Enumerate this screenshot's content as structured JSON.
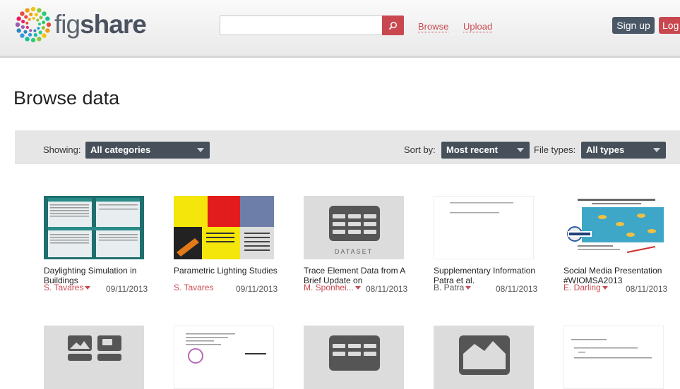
{
  "brand": {
    "name_light": "fig",
    "name_bold": "share"
  },
  "search": {
    "placeholder": ""
  },
  "nav": {
    "browse": "Browse",
    "upload": "Upload"
  },
  "auth": {
    "signup": "Sign up",
    "login": "Log"
  },
  "page": {
    "title": "Browse data"
  },
  "filters": {
    "showing_label": "Showing:",
    "showing_value": "All categories",
    "sort_label": "Sort by:",
    "sort_value": "Most recent",
    "filetypes_label": "File types:",
    "filetypes_value": "All types"
  },
  "items": [
    {
      "title": "Daylighting Simulation in Buildings",
      "author": "S. Tavares",
      "date": "09/11/2013",
      "thumb": "poster-teal"
    },
    {
      "title": "Parametric Lighting Studies",
      "author": "S. Tavares",
      "date": "09/11/2013",
      "thumb": "colorful-grid"
    },
    {
      "title": "Trace Element Data from A Brief Update on",
      "author": "M. Sponhei...",
      "date": "08/11/2013",
      "thumb": "dataset-icon",
      "thumb_label": "DATASET"
    },
    {
      "title": "Supplementary Information Patra et al.",
      "author": "B. Patra",
      "date": "08/11/2013",
      "thumb": "text-document"
    },
    {
      "title": "Social Media Presentation #WIOMSA2013",
      "author": "E. Darling",
      "date": "08/11/2013",
      "thumb": "fish-slide"
    }
  ],
  "colors": {
    "accent": "#c9484f",
    "dark": "#47505a",
    "filter_bg": "#e6e6e6",
    "thumb_bg": "#dcdcdc"
  }
}
